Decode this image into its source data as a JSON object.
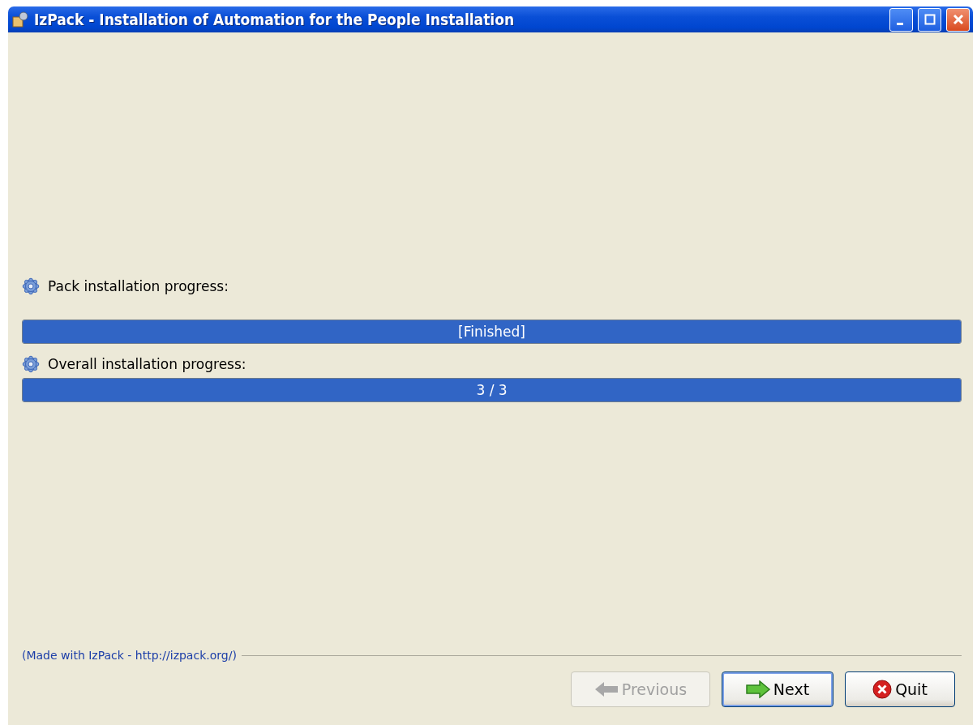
{
  "window": {
    "title": "IzPack - Installation of Automation for the People Installation"
  },
  "progress": [
    {
      "label": "Pack installation progress:",
      "level": 1,
      "reading": "[Finished]"
    },
    {
      "label": "Overall installation progress:",
      "level": 1,
      "reading": "3 / 3"
    }
  ],
  "footer": {
    "credit": "(Made with IzPack - http://izpack.org/)"
  },
  "buttons": [
    {
      "kind": "previous",
      "label": "Previous",
      "disabled": true
    },
    {
      "kind": "next",
      "label": "Next",
      "disabled": false
    },
    {
      "kind": "quit",
      "label": "Quit",
      "disabled": false
    }
  ]
}
